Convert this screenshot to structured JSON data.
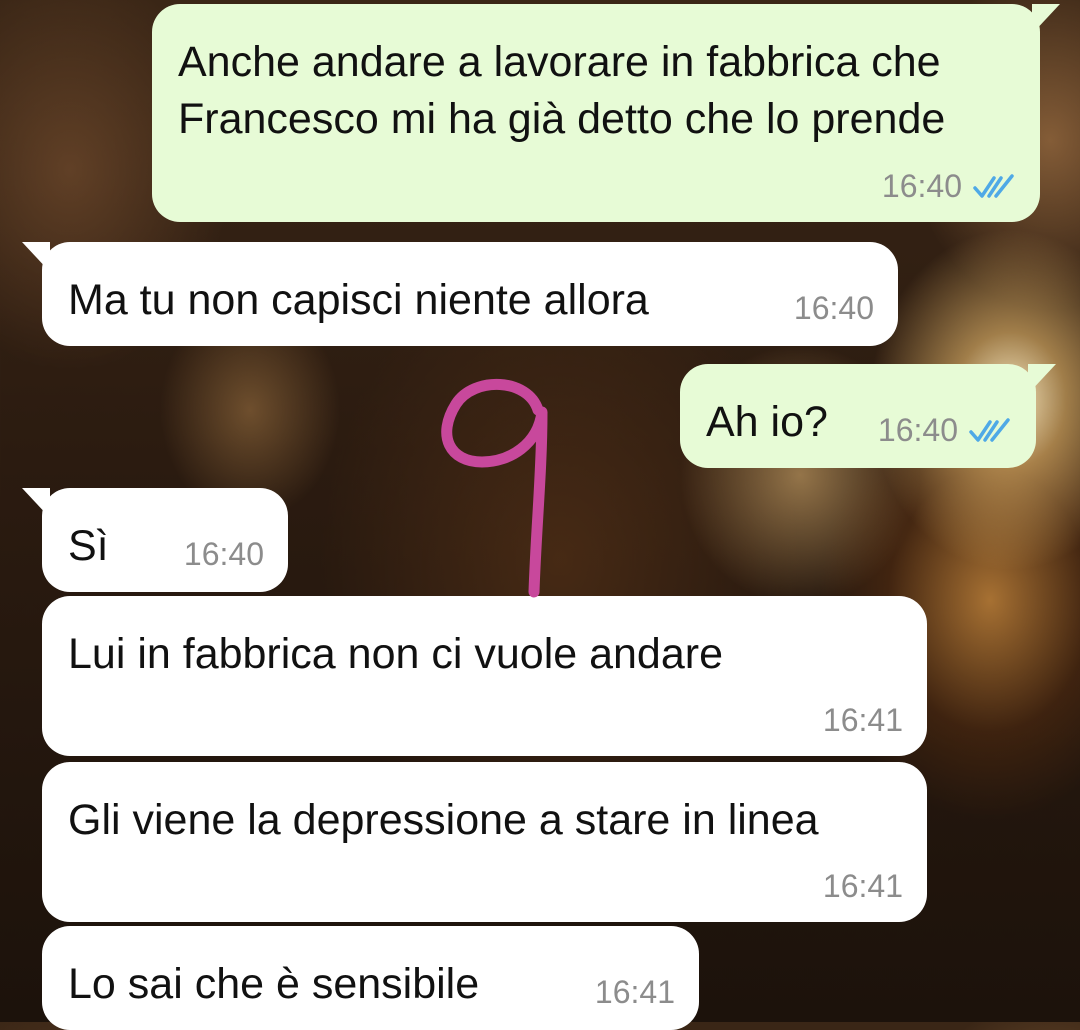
{
  "messages": [
    {
      "direction": "outgoing",
      "text": "Anche andare a lavorare in fabbrica che Francesco mi ha già detto che lo prende",
      "time": "16:40",
      "status_icon": "double-check-read-icon"
    },
    {
      "direction": "incoming",
      "text": "Ma tu non capisci niente allora",
      "time": "16:40"
    },
    {
      "direction": "outgoing",
      "text": "Ah io?",
      "time": "16:40",
      "status_icon": "double-check-read-icon"
    },
    {
      "direction": "incoming",
      "text": "Sì",
      "time": "16:40"
    },
    {
      "direction": "incoming",
      "text": "Lui in fabbrica non ci vuole andare",
      "time": "16:41"
    },
    {
      "direction": "incoming",
      "text": "Gli viene la depressione a stare in linea",
      "time": "16:41"
    },
    {
      "direction": "incoming",
      "text": "Lo sai che è sensibile",
      "time": "16:41"
    }
  ],
  "colors": {
    "outgoing_bubble": "#e7fbd6",
    "incoming_bubble": "#ffffff",
    "timestamp": "#8c8c8c",
    "read_tick": "#4fa9e6",
    "doodle": "#c8489c"
  },
  "overlay": {
    "doodle_icon": "handwritten-number-doodle"
  }
}
